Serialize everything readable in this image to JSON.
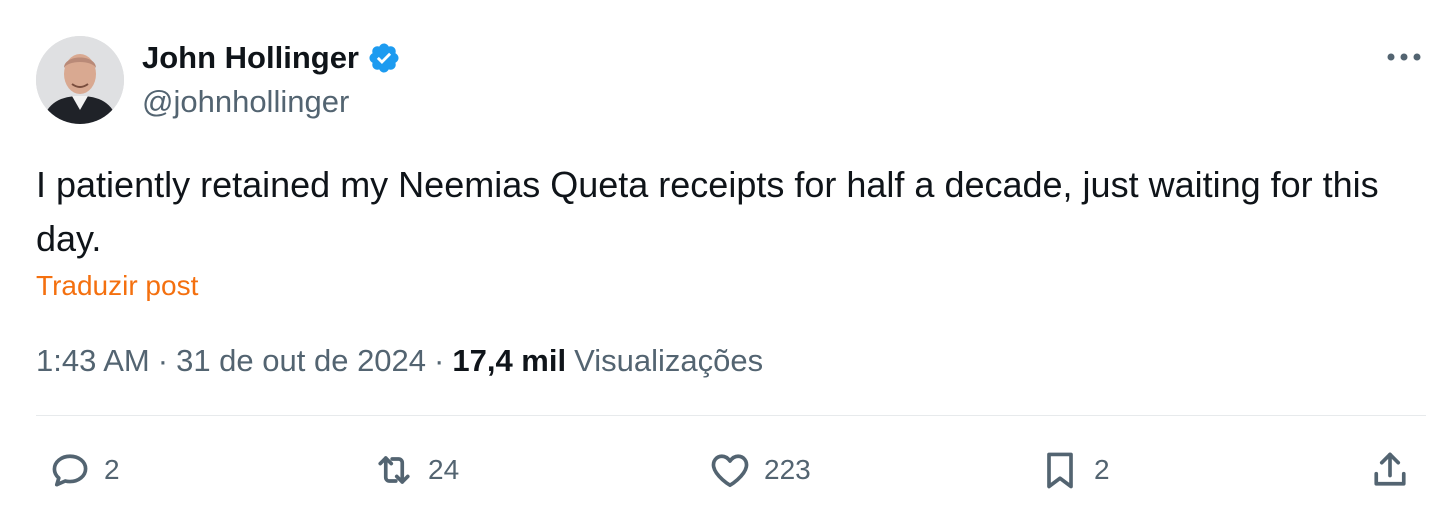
{
  "author": {
    "display_name": "John Hollinger",
    "handle": "@johnhollinger",
    "verified_icon": "verified-badge-icon",
    "verified_color": "#1d9bf0"
  },
  "post": {
    "text": "I patiently retained my Neemias Queta receipts for half a decade, just waiting for this day.",
    "translate_label": "Traduzir post",
    "time": "1:43 AM",
    "date": "31 de out de 2024",
    "views_count": "17,4 mil",
    "views_label": "Visualizações",
    "separator": "·"
  },
  "actions": {
    "replies": "2",
    "reposts": "24",
    "likes": "223",
    "bookmarks": "2"
  },
  "colors": {
    "text": "#0f1419",
    "muted": "#536471",
    "translate_link": "#f4700f",
    "divider": "#e7eaec"
  }
}
